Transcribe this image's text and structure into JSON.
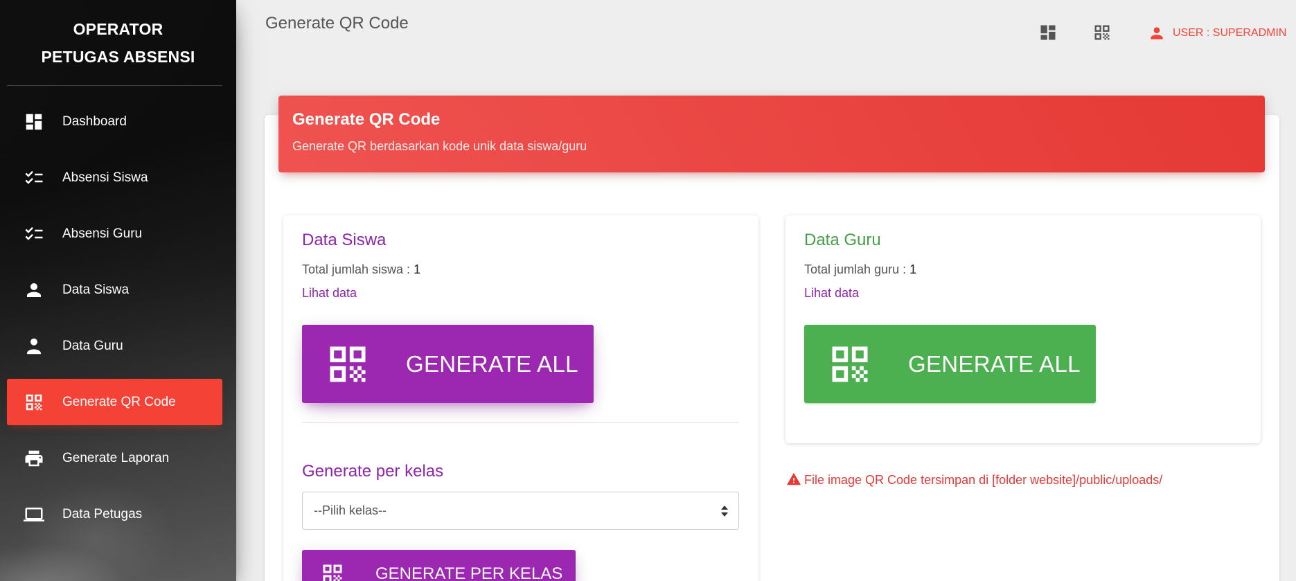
{
  "sidebar": {
    "brand_line1": "OPERATOR",
    "brand_line2": "PETUGAS ABSENSI",
    "items": [
      {
        "label": "Dashboard",
        "icon": "dashboard-icon"
      },
      {
        "label": "Absensi Siswa",
        "icon": "checklist-icon"
      },
      {
        "label": "Absensi Guru",
        "icon": "checklist-icon"
      },
      {
        "label": "Data Siswa",
        "icon": "person-icon"
      },
      {
        "label": "Data Guru",
        "icon": "person-icon"
      },
      {
        "label": "Generate QR Code",
        "icon": "qr-code-icon",
        "active": true
      },
      {
        "label": "Generate Laporan",
        "icon": "printer-icon"
      },
      {
        "label": "Data Petugas",
        "icon": "laptop-icon"
      }
    ]
  },
  "topbar": {
    "page_title": "Generate QR Code",
    "user_label": "USER : SUPERADMIN"
  },
  "card": {
    "title": "Generate QR Code",
    "subtitle": "Generate QR berdasarkan kode unik data siswa/guru"
  },
  "siswa": {
    "title": "Data Siswa",
    "total_label": "Total jumlah siswa : ",
    "total_value": "1",
    "link": "Lihat data",
    "generate_all": "GENERATE ALL",
    "per_kelas_title": "Generate per kelas",
    "select_placeholder": "--Pilih kelas--",
    "generate_per_kelas": "GENERATE PER KELAS"
  },
  "guru": {
    "title": "Data Guru",
    "total_label": "Total jumlah guru : ",
    "total_value": "1",
    "link": "Lihat data",
    "generate_all": "GENERATE ALL"
  },
  "note": "File image QR Code tersimpan di [folder website]/public/uploads/",
  "colors": {
    "accent_red": "#f44336",
    "purple": "#9c27b0",
    "green": "#4caf50"
  }
}
